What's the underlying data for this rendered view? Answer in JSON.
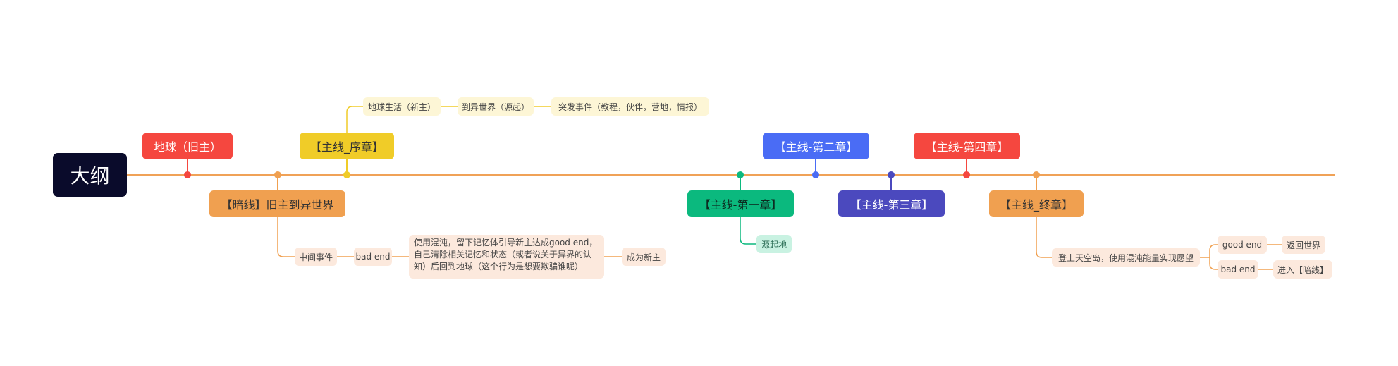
{
  "colors": {
    "timeline": "#f0a257",
    "red": "#f5473f",
    "yellow": "#f0cc28",
    "orange": "#f0a050",
    "green": "#0bb97e",
    "blue": "#4a6cf5",
    "indigo": "#4b49be",
    "root": "#0a0b2b"
  },
  "root": {
    "label": "大纲"
  },
  "nodes": {
    "earth_old": "地球（旧主）",
    "prologue": "【主线_序章】",
    "dark_line": "【暗线】旧主到异世界",
    "chapter1": "【主线-第一章】",
    "chapter2": "【主线-第二章】",
    "chapter3": "【主线-第三章】",
    "chapter4": "【主线-第四章】",
    "final": "【主线_终章】"
  },
  "prologue_children": [
    "地球生活（新主）",
    "到异世界（源起）",
    "突发事件（教程，伙伴，营地，情报）"
  ],
  "dark_children": {
    "middle": "中间事件",
    "bad_end": "bad end",
    "description": "使用混沌，留下记忆体引导新主达成good end，自己清除相关记忆和状态（或者说关于异界的认知）后回到地球（这个行为是想要欺骗谁呢）",
    "result": "成为新主"
  },
  "chapter1_children": [
    "源起地"
  ],
  "final_children": {
    "main": "登上天空岛，使用混沌能量实现愿望",
    "good_end": "good end",
    "good_result": "返回世界",
    "bad_end": "bad end",
    "bad_result": "进入【暗线】"
  }
}
